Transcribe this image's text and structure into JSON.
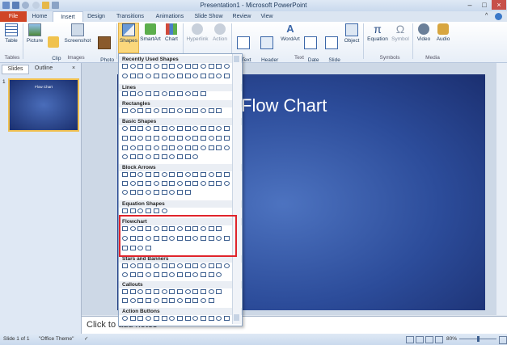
{
  "window": {
    "title": "Presentation1 - Microsoft PowerPoint"
  },
  "tabs": [
    {
      "label": "File"
    },
    {
      "label": "Home"
    },
    {
      "label": "Insert"
    },
    {
      "label": "Design"
    },
    {
      "label": "Transitions"
    },
    {
      "label": "Animations"
    },
    {
      "label": "Slide Show"
    },
    {
      "label": "Review"
    },
    {
      "label": "View"
    }
  ],
  "ribbon": {
    "buttons": [
      {
        "label": "Table",
        "icon": "table-icon"
      },
      {
        "label": "Picture",
        "icon": "picture-icon"
      },
      {
        "label": "Clip\nArt",
        "icon": "clip-art-icon"
      },
      {
        "label": "Screenshot",
        "icon": "screenshot-icon"
      },
      {
        "label": "Photo\nAlbum",
        "icon": "photo-album-icon"
      },
      {
        "label": "Shapes",
        "icon": "shapes-icon"
      },
      {
        "label": "SmartArt",
        "icon": "smartart-icon"
      },
      {
        "label": "Chart",
        "icon": "chart-icon"
      },
      {
        "label": "Hyperlink",
        "icon": "hyperlink-icon"
      },
      {
        "label": "Action",
        "icon": "action-icon"
      },
      {
        "label": "Text\nBox",
        "icon": "text-box-icon"
      },
      {
        "label": "Header\n& Footer",
        "icon": "header-footer-icon"
      },
      {
        "label": "WordArt",
        "icon": "wordart-icon"
      },
      {
        "label": "Date\n& Time",
        "icon": "date-time-icon"
      },
      {
        "label": "Slide\nNumber",
        "icon": "slide-number-icon"
      },
      {
        "label": "Object",
        "icon": "object-icon"
      },
      {
        "label": "Equation",
        "icon": "equation-icon"
      },
      {
        "label": "Symbol",
        "icon": "symbol-icon"
      },
      {
        "label": "Video",
        "icon": "video-icon"
      },
      {
        "label": "Audio",
        "icon": "audio-icon"
      }
    ],
    "groups": [
      "Tables",
      "Images",
      "Text",
      "Symbols",
      "Media"
    ]
  },
  "left_panel": {
    "tabs": [
      "Slides",
      "Outline"
    ],
    "close": "×",
    "slide_number": "1",
    "thumb_title": "Flow Chart"
  },
  "slide": {
    "title": "Flow Chart"
  },
  "notes": {
    "placeholder": "Click to add notes"
  },
  "status": {
    "slide_info": "Slide 1 of 1",
    "theme": "\"Office Theme\"",
    "zoom": "80%"
  },
  "shapes_menu": {
    "sections": [
      "Recently Used Shapes",
      "Lines",
      "Rectangles",
      "Basic Shapes",
      "Block Arrows",
      "Equation Shapes",
      "Flowchart",
      "Stars and Banners",
      "Callouts",
      "Action Buttons"
    ]
  },
  "colors": {
    "file_tab": "#d04525",
    "highlight": "#fbd87c",
    "flowchart_box": "#e0242b",
    "slide_bg": "#2c4c9a"
  }
}
